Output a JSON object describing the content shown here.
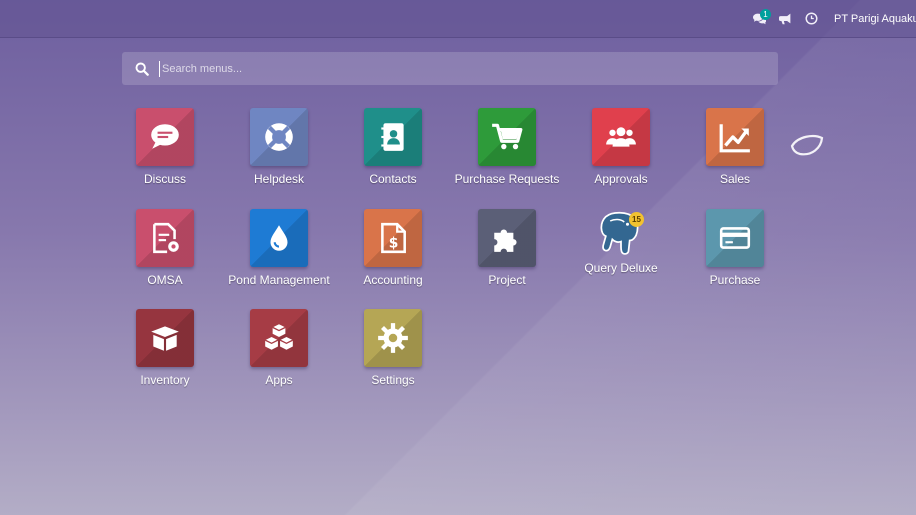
{
  "systray": {
    "messages_badge": "1",
    "company_name": "PT Parigi Aquaku"
  },
  "search": {
    "placeholder": "Search menus..."
  },
  "apps": [
    {
      "label": "Discuss",
      "icon": "chat-bubble-icon",
      "color": "#c94f6d"
    },
    {
      "label": "Helpdesk",
      "icon": "lifebuoy-icon",
      "color": "#6f86c2"
    },
    {
      "label": "Contacts",
      "icon": "address-book-icon",
      "color": "#1f8f8a"
    },
    {
      "label": "Purchase Requests",
      "icon": "shopping-cart-icon",
      "color": "#2e9b3a"
    },
    {
      "label": "Approvals",
      "icon": "users-icon",
      "color": "#e0404d"
    },
    {
      "label": "Sales",
      "icon": "chart-line-icon",
      "color": "#d9744a"
    },
    {
      "label": "OMSA",
      "icon": "document-gear-icon",
      "color": "#c94f6d"
    },
    {
      "label": "Pond Management",
      "icon": "water-drop-icon",
      "color": "#1e7bd4"
    },
    {
      "label": "Accounting",
      "icon": "invoice-dollar-icon",
      "color": "#d9744a"
    },
    {
      "label": "Project",
      "icon": "puzzle-icon",
      "color": "#5b5f77"
    },
    {
      "label": "Query Deluxe",
      "icon": "postgresql-elephant-icon",
      "color": "#336791",
      "badge": "15"
    },
    {
      "label": "Purchase",
      "icon": "credit-card-icon",
      "color": "#5c97ad"
    },
    {
      "label": "Inventory",
      "icon": "box-icon",
      "color": "#96353f"
    },
    {
      "label": "Apps",
      "icon": "cubes-icon",
      "color": "#a63c45"
    },
    {
      "label": "Settings",
      "icon": "gear-icon",
      "color": "#b5a655"
    }
  ]
}
